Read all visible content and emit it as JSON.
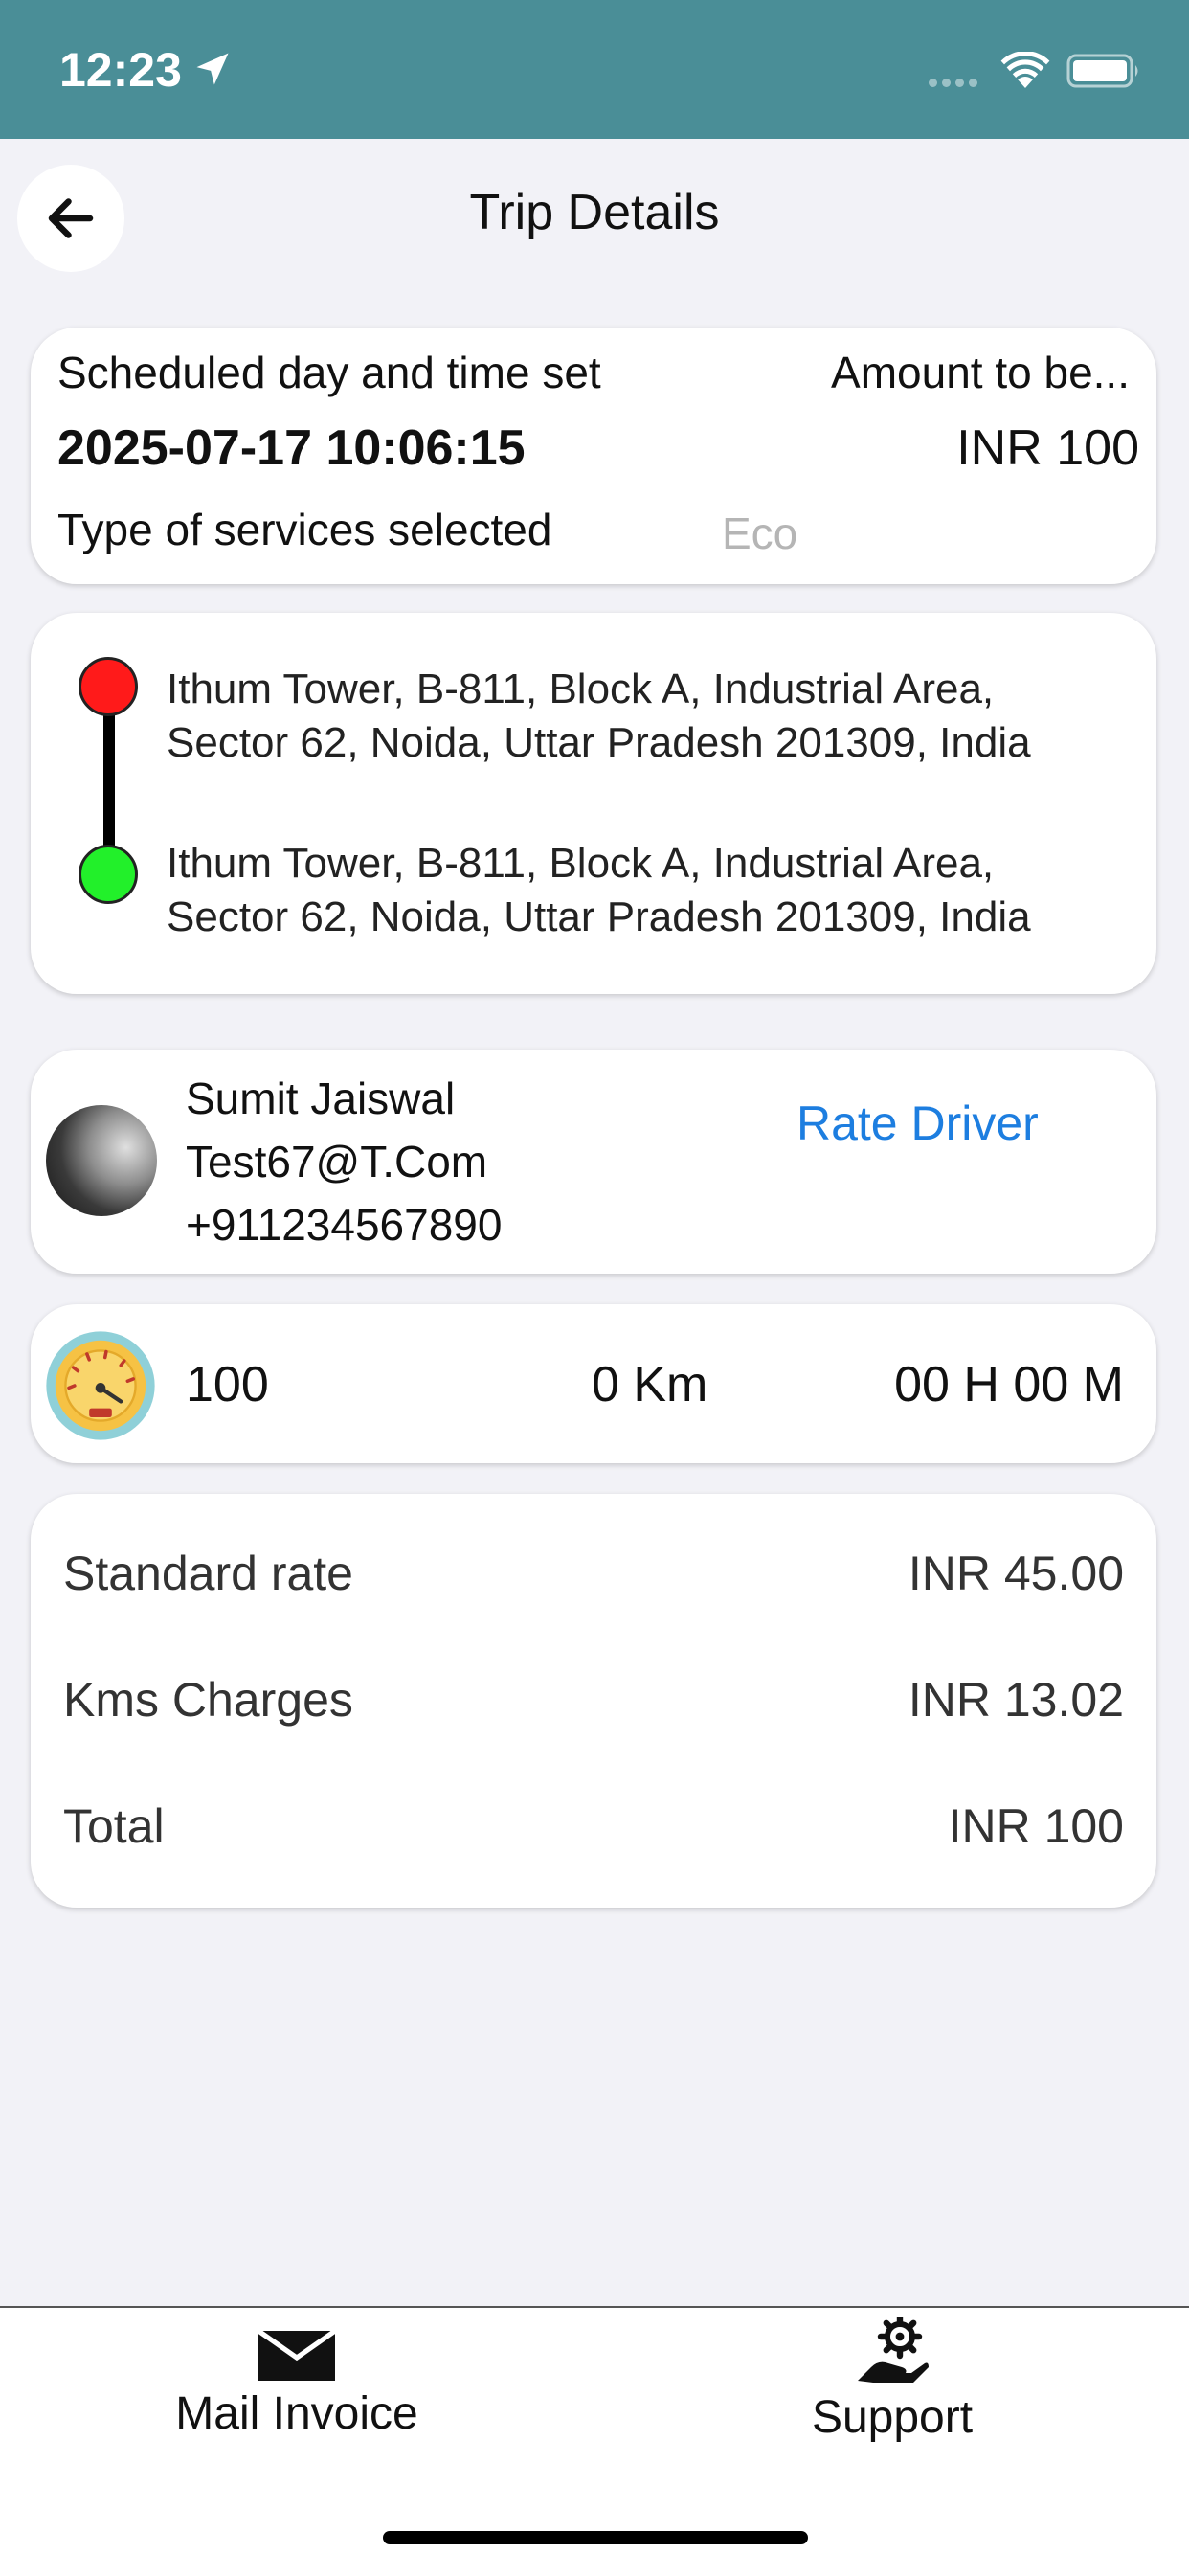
{
  "status_bar": {
    "time": "12:23",
    "icons": [
      "location-arrow-icon",
      "signal-dots-icon",
      "wifi-icon",
      "battery-icon"
    ]
  },
  "header": {
    "title": "Trip Details",
    "back_icon": "arrow-left-icon"
  },
  "schedule": {
    "label": "Scheduled day and time set",
    "datetime": "2025-07-17 10:06:15",
    "amount_label": "Amount to be...",
    "amount_value": "INR 100",
    "service_label": "Type of services selected",
    "service_value": "Eco"
  },
  "route": {
    "pickup": "Ithum Tower, B-811, Block A, Industrial Area,\nSector 62, Noida, Uttar Pradesh 201309, India",
    "dropoff": "Ithum Tower, B-811, Block A, Industrial Area,\nSector 62, Noida, Uttar Pradesh 201309, India",
    "pickup_color": "#ff1a1a",
    "dropoff_color": "#22f02a"
  },
  "driver": {
    "name": "Sumit Jaiswal",
    "email": "Test67@T.Com",
    "phone": "+911234567890",
    "rate_label": "Rate Driver"
  },
  "trip_stats": {
    "icon": "speedometer-icon",
    "fare": "100",
    "distance": "0 Km",
    "duration": "00 H 00 M"
  },
  "fare_breakdown": {
    "rows": [
      {
        "label": "Standard rate",
        "value": "INR 45.00"
      },
      {
        "label": "Kms Charges",
        "value": "INR 13.02"
      },
      {
        "label": "Total",
        "value": "INR 100"
      }
    ]
  },
  "bottom_bar": {
    "mail_label": "Mail Invoice",
    "support_label": "Support"
  },
  "colors": {
    "status_bar": "#4a8e97",
    "accent_link": "#1d7ee0",
    "background": "#f2f2f7"
  }
}
